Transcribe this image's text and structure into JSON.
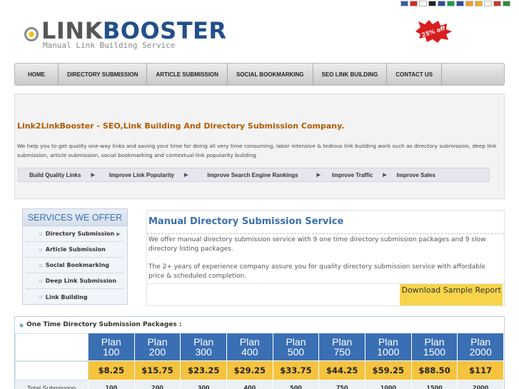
{
  "flags": [
    {
      "name": "us-flag",
      "color": "#3c5aa8"
    },
    {
      "name": "cn-flag",
      "color": "#d52b1e"
    },
    {
      "name": "jp-flag",
      "color": "#ffffff"
    },
    {
      "name": "de-flag",
      "color": "#222222"
    },
    {
      "name": "fr-flag",
      "color": "#2a4fa0"
    },
    {
      "name": "it-flag",
      "color": "#1c9a48"
    },
    {
      "name": "ru-flag",
      "color": "#2c4fa6"
    },
    {
      "name": "in-flag",
      "color": "#f39a2b"
    },
    {
      "name": "es-flag",
      "color": "#e2b21c"
    },
    {
      "name": "kr-flag",
      "color": "#ffffff"
    },
    {
      "name": "nl-flag",
      "color": "#c43a36"
    },
    {
      "name": "pt-flag",
      "color": "#2f8a3b"
    }
  ],
  "logo": {
    "link": "LINK",
    "booster": "BOOSTER",
    "tagline": "Manual Link Building Service"
  },
  "badge": {
    "text": "25% off",
    "color": "#d81e1e"
  },
  "nav": [
    "HOME",
    "DIRECTORY SUBMISSION",
    "ARTICLE SUBMISSION",
    "SOCIAL BOOKMARKING",
    "SEO LINK BUILDING",
    "CONTACT US"
  ],
  "intro": {
    "title": "Link2LinkBooster - SEO,Link Building And Directory Submission Company.",
    "text": "We help you to get quality one-way links and saving your time for doing all very time consuming, labor intensive & tedious link building work such as directory submission, deep link submission, article submission, social bookmarking and contextual link popularity building.",
    "benefits": [
      "Build Quality Links",
      "Improve Link Popularity",
      "Improve Search Engine Rankings",
      "Improve Traffic",
      "Improve Sales"
    ]
  },
  "services": {
    "heading": "SERVICES WE OFFER",
    "items": [
      "Directory Submission",
      "Article Submission",
      "Social Bookmarking",
      "Deep Link Submission",
      "Link Building"
    ]
  },
  "mds": {
    "title": "Manual Directory Submission Service",
    "p1": "We offer manual directory submission service with 9 one time directory submission packages and 9 slow directory listing packages.",
    "p2": "The 2+ years of experience company assure you for quality directory submission service with affordable price & scheduled completion.",
    "download": "Download Sample Report"
  },
  "packages": {
    "heading": "One Time Directory Submission Packages :",
    "plans": [
      "Plan 100",
      "Plan 200",
      "Plan 300",
      "Plan 400",
      "Plan 500",
      "Plan 750",
      "Plan 1000",
      "Plan 1500",
      "Plan 2000"
    ],
    "prices": [
      "$8.25",
      "$15.75",
      "$23.25",
      "$29.25",
      "$33.75",
      "$44.25",
      "$59.25",
      "$88.50",
      "$117"
    ],
    "row_label": "Total Submission",
    "submissions": [
      "100",
      "200",
      "300",
      "400",
      "500",
      "750",
      "1000",
      "1500",
      "2000"
    ]
  }
}
